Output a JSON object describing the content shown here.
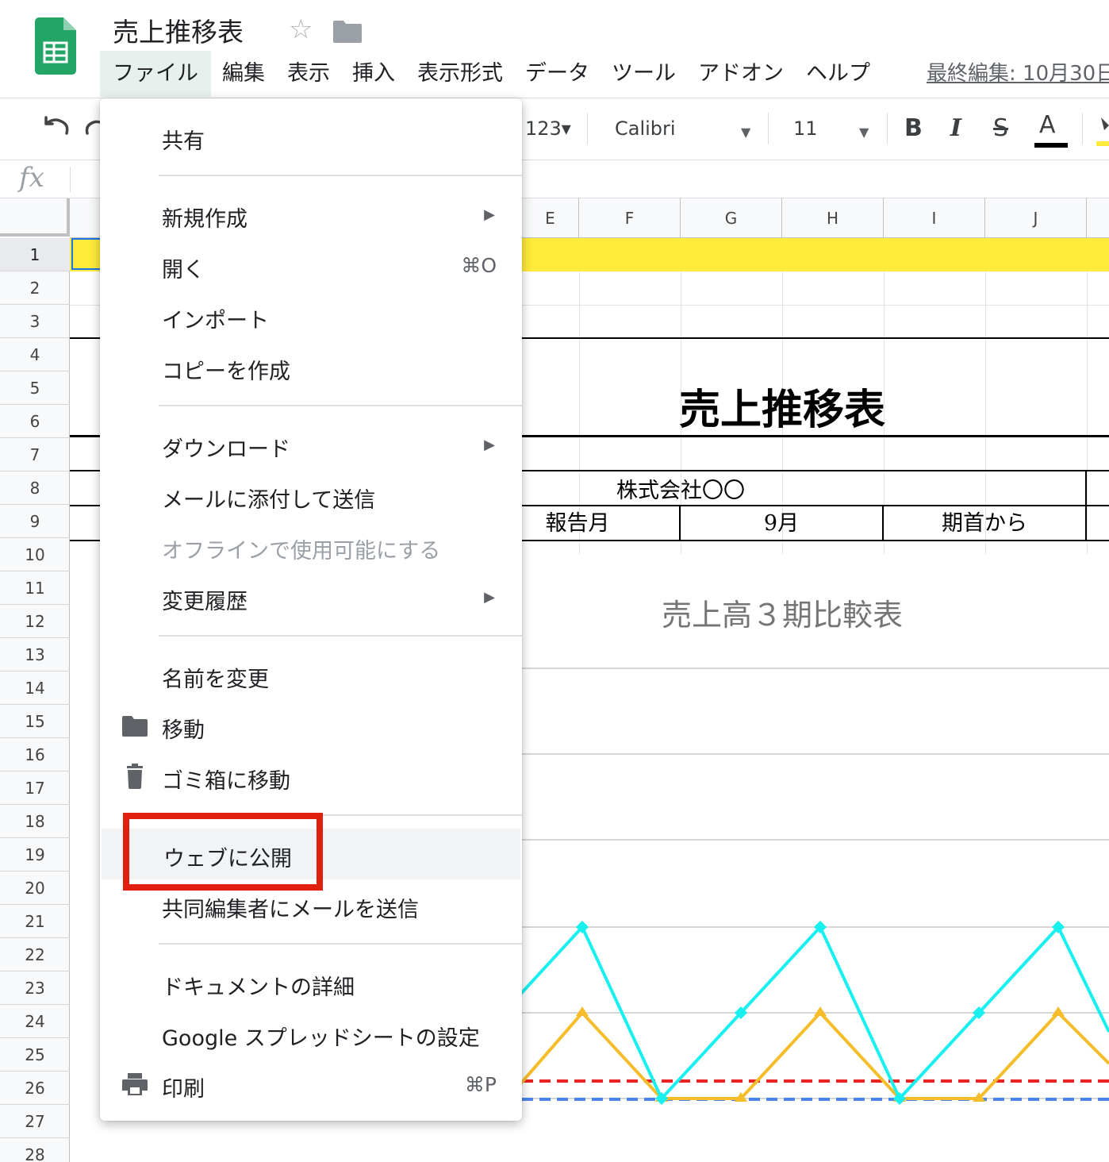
{
  "header": {
    "doc_title": "売上推移表",
    "last_edit": "最終編集: 10月30日"
  },
  "menubar": {
    "items": [
      "ファイル",
      "編集",
      "表示",
      "挿入",
      "表示形式",
      "データ",
      "ツール",
      "アドオン",
      "ヘルプ"
    ],
    "active": "ファイル"
  },
  "toolbar": {
    "num_format": "123▾",
    "font_name": "Calibri",
    "font_size": "11",
    "bold": "B",
    "italic": "I",
    "strike": "S",
    "text_color": "A"
  },
  "formula_bar": {
    "fx": "fx"
  },
  "grid": {
    "columns": [
      "E",
      "F",
      "G",
      "H",
      "I",
      "J"
    ],
    "rows": [
      "1",
      "2",
      "3",
      "4",
      "5",
      "6",
      "7",
      "8",
      "9",
      "10",
      "11",
      "12",
      "13",
      "14",
      "15",
      "16",
      "17",
      "18",
      "19",
      "20",
      "21",
      "22",
      "23",
      "24",
      "25",
      "26",
      "27",
      "28"
    ],
    "selected_row": "1"
  },
  "sheet": {
    "title": "売上推移表",
    "company": "株式会社〇〇",
    "report_month_label": "報告月",
    "report_month_value": "9月",
    "period_label": "期首から"
  },
  "chart": {
    "title": "売上高３期比較表"
  },
  "file_menu": {
    "share": "共有",
    "new": "新規作成",
    "open": "開く",
    "open_shortcut": "⌘O",
    "import": "インポート",
    "make_copy": "コピーを作成",
    "download": "ダウンロード",
    "email_attachment": "メールに添付して送信",
    "offline": "オフラインで使用可能にする",
    "version_history": "変更履歴",
    "rename": "名前を変更",
    "move": "移動",
    "move_to_trash": "ゴミ箱に移動",
    "publish_to_web": "ウェブに公開",
    "email_collaborators": "共同編集者にメールを送信",
    "document_details": "ドキュメントの詳細",
    "settings": "Google スプレッドシートの設定",
    "print": "印刷",
    "print_shortcut": "⌘P"
  },
  "colors": {
    "accent_highlight": "#e0200e",
    "row1_fill": "#ffeb3b",
    "series_cyan": "#18f0f0",
    "series_orange": "#f6bd2a",
    "series_red": "#ea2222",
    "series_blue": "#4a86e8"
  }
}
